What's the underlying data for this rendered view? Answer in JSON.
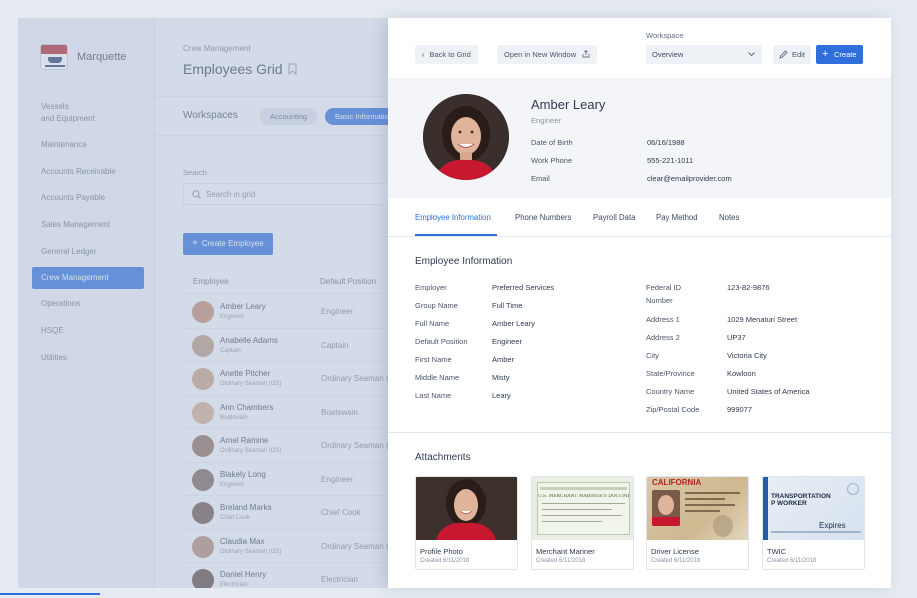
{
  "app": {
    "name": "Marquette"
  },
  "sidebar": {
    "items": [
      {
        "label": "Vessels\nand Equipment",
        "active": false
      },
      {
        "label": "Maintenance",
        "active": false
      },
      {
        "label": "Accounts Receivable",
        "active": false
      },
      {
        "label": "Accounts Payable",
        "active": false
      },
      {
        "label": "Sales Management",
        "active": false
      },
      {
        "label": "General Ledger",
        "active": false
      },
      {
        "label": "Crew Management",
        "active": true
      },
      {
        "label": "Operations",
        "active": false
      },
      {
        "label": "HSQE",
        "active": false
      },
      {
        "label": "Utilities",
        "active": false
      }
    ]
  },
  "main": {
    "breadcrumb": "Crew Management",
    "title": "Employees Grid",
    "workspaces_label": "Workspaces",
    "workspace_pills": [
      "Accounting",
      "Basic Information"
    ],
    "search_label": "Search",
    "search_placeholder": "Search in grid",
    "create_button": "Create Employee",
    "columns": [
      "Employee",
      "Default Position"
    ],
    "rows": [
      {
        "name": "Amber Leary",
        "role": "Engineer",
        "position": "Engineer",
        "avatar": "#c28a6f"
      },
      {
        "name": "Anabelle Adams",
        "role": "Captain",
        "position": "Captain",
        "avatar": "#b79a80"
      },
      {
        "name": "Anette Pitcher",
        "role": "Ordinary Seaman (OS)",
        "position": "Ordinary Seaman (OS)",
        "avatar": "#c9a184"
      },
      {
        "name": "Ann Chambers",
        "role": "Boatswain",
        "position": "Boatswain",
        "avatar": "#d1ad8c"
      },
      {
        "name": "Arnel Ramine",
        "role": "Ordinary Seaman (OS)",
        "position": "Ordinary Seaman (OS)",
        "avatar": "#8d6f5b"
      },
      {
        "name": "Blakely Long",
        "role": "Engineer",
        "position": "Engineer",
        "avatar": "#7a6456"
      },
      {
        "name": "Breland Marks",
        "role": "Chief Cook",
        "position": "Chief Cook",
        "avatar": "#6e5748"
      },
      {
        "name": "Claudia Max",
        "role": "Ordinary Seaman (OS)",
        "position": "Ordinary Seaman (OS)",
        "avatar": "#b08a72"
      },
      {
        "name": "Daniel Henry",
        "role": "Electrician",
        "position": "Electrician",
        "avatar": "#5f4c40"
      }
    ]
  },
  "panel": {
    "back_button": "Back to Grid",
    "new_window_button": "Open in New Window",
    "workspace_caption": "Workspace",
    "workspace_value": "Overview",
    "edit_button": "Edit",
    "create_button": "Create",
    "profile": {
      "name": "Amber Leary",
      "role": "Engineer",
      "fields": [
        {
          "label": "Date of Birth",
          "value": "06/16/1988"
        },
        {
          "label": "Work Phone",
          "value": "555-221-1011"
        },
        {
          "label": "Email",
          "value": "clear@emailprovider.com"
        }
      ]
    },
    "tabs": [
      "Employee Information",
      "Phone Numbers",
      "Payroll Data",
      "Pay Method",
      "Notes"
    ],
    "info_title": "Employee Information",
    "info_left": [
      {
        "label": "Employer",
        "value": "Preferred Services"
      },
      {
        "label": "Group Name",
        "value": "Full Time"
      },
      {
        "label": "Full Name",
        "value": "Amber Leary"
      },
      {
        "label": "Default Position",
        "value": "Engineer"
      },
      {
        "label": "First Name",
        "value": "Amber"
      },
      {
        "label": "Middle Name",
        "value": "Misty"
      },
      {
        "label": "Last Name",
        "value": "Leary"
      }
    ],
    "info_right": [
      {
        "label": "Federal ID\nNumber",
        "value": "123-82-9876"
      },
      {
        "label": "Address 1",
        "value": "1029 Menaturi Street"
      },
      {
        "label": "Address 2",
        "value": "UP37"
      },
      {
        "label": "City",
        "value": "Victoria City"
      },
      {
        "label": "State/Province",
        "value": "Kowloon"
      },
      {
        "label": "Country Name",
        "value": "United States of America"
      },
      {
        "label": "Zip/Postal Code",
        "value": "999077"
      }
    ],
    "attachments_title": "Attachments",
    "attachments": [
      {
        "name": "Profile Photo",
        "date": "Created 6/11/2018"
      },
      {
        "name": "Merchant Mariner",
        "date": "Created 6/11/2018",
        "doc_header": "U.S. MERCHANT MARINER'S DOCUMENT"
      },
      {
        "name": "Driver License",
        "date": "Created 6/11/2018",
        "doc_header": "CALIFORNIA"
      },
      {
        "name": "TWIC",
        "date": "Created 6/11/2018",
        "doc_header": "TRANSPORTATION\nP WORKER",
        "doc_footer": "Expires"
      }
    ]
  },
  "colors": {
    "accent": "#2e6fdc",
    "sidebar_bg": "#eef1f6",
    "panel_bg": "#ffffff"
  }
}
